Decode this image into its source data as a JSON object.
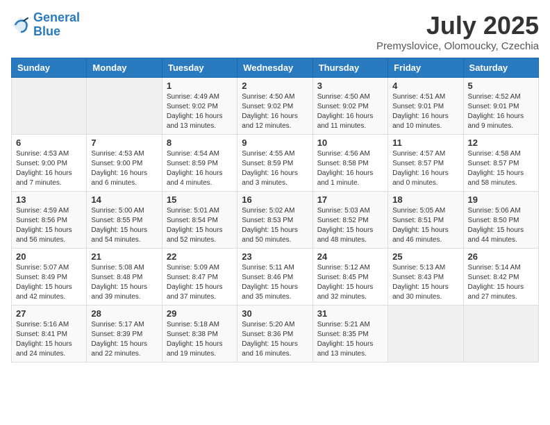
{
  "header": {
    "logo_line1": "General",
    "logo_line2": "Blue",
    "month": "July 2025",
    "location": "Premyslovice, Olomoucky, Czechia"
  },
  "weekdays": [
    "Sunday",
    "Monday",
    "Tuesday",
    "Wednesday",
    "Thursday",
    "Friday",
    "Saturday"
  ],
  "weeks": [
    [
      {
        "day": "",
        "info": ""
      },
      {
        "day": "",
        "info": ""
      },
      {
        "day": "1",
        "info": "Sunrise: 4:49 AM\nSunset: 9:02 PM\nDaylight: 16 hours and 13 minutes."
      },
      {
        "day": "2",
        "info": "Sunrise: 4:50 AM\nSunset: 9:02 PM\nDaylight: 16 hours and 12 minutes."
      },
      {
        "day": "3",
        "info": "Sunrise: 4:50 AM\nSunset: 9:02 PM\nDaylight: 16 hours and 11 minutes."
      },
      {
        "day": "4",
        "info": "Sunrise: 4:51 AM\nSunset: 9:01 PM\nDaylight: 16 hours and 10 minutes."
      },
      {
        "day": "5",
        "info": "Sunrise: 4:52 AM\nSunset: 9:01 PM\nDaylight: 16 hours and 9 minutes."
      }
    ],
    [
      {
        "day": "6",
        "info": "Sunrise: 4:53 AM\nSunset: 9:00 PM\nDaylight: 16 hours and 7 minutes."
      },
      {
        "day": "7",
        "info": "Sunrise: 4:53 AM\nSunset: 9:00 PM\nDaylight: 16 hours and 6 minutes."
      },
      {
        "day": "8",
        "info": "Sunrise: 4:54 AM\nSunset: 8:59 PM\nDaylight: 16 hours and 4 minutes."
      },
      {
        "day": "9",
        "info": "Sunrise: 4:55 AM\nSunset: 8:59 PM\nDaylight: 16 hours and 3 minutes."
      },
      {
        "day": "10",
        "info": "Sunrise: 4:56 AM\nSunset: 8:58 PM\nDaylight: 16 hours and 1 minute."
      },
      {
        "day": "11",
        "info": "Sunrise: 4:57 AM\nSunset: 8:57 PM\nDaylight: 16 hours and 0 minutes."
      },
      {
        "day": "12",
        "info": "Sunrise: 4:58 AM\nSunset: 8:57 PM\nDaylight: 15 hours and 58 minutes."
      }
    ],
    [
      {
        "day": "13",
        "info": "Sunrise: 4:59 AM\nSunset: 8:56 PM\nDaylight: 15 hours and 56 minutes."
      },
      {
        "day": "14",
        "info": "Sunrise: 5:00 AM\nSunset: 8:55 PM\nDaylight: 15 hours and 54 minutes."
      },
      {
        "day": "15",
        "info": "Sunrise: 5:01 AM\nSunset: 8:54 PM\nDaylight: 15 hours and 52 minutes."
      },
      {
        "day": "16",
        "info": "Sunrise: 5:02 AM\nSunset: 8:53 PM\nDaylight: 15 hours and 50 minutes."
      },
      {
        "day": "17",
        "info": "Sunrise: 5:03 AM\nSunset: 8:52 PM\nDaylight: 15 hours and 48 minutes."
      },
      {
        "day": "18",
        "info": "Sunrise: 5:05 AM\nSunset: 8:51 PM\nDaylight: 15 hours and 46 minutes."
      },
      {
        "day": "19",
        "info": "Sunrise: 5:06 AM\nSunset: 8:50 PM\nDaylight: 15 hours and 44 minutes."
      }
    ],
    [
      {
        "day": "20",
        "info": "Sunrise: 5:07 AM\nSunset: 8:49 PM\nDaylight: 15 hours and 42 minutes."
      },
      {
        "day": "21",
        "info": "Sunrise: 5:08 AM\nSunset: 8:48 PM\nDaylight: 15 hours and 39 minutes."
      },
      {
        "day": "22",
        "info": "Sunrise: 5:09 AM\nSunset: 8:47 PM\nDaylight: 15 hours and 37 minutes."
      },
      {
        "day": "23",
        "info": "Sunrise: 5:11 AM\nSunset: 8:46 PM\nDaylight: 15 hours and 35 minutes."
      },
      {
        "day": "24",
        "info": "Sunrise: 5:12 AM\nSunset: 8:45 PM\nDaylight: 15 hours and 32 minutes."
      },
      {
        "day": "25",
        "info": "Sunrise: 5:13 AM\nSunset: 8:43 PM\nDaylight: 15 hours and 30 minutes."
      },
      {
        "day": "26",
        "info": "Sunrise: 5:14 AM\nSunset: 8:42 PM\nDaylight: 15 hours and 27 minutes."
      }
    ],
    [
      {
        "day": "27",
        "info": "Sunrise: 5:16 AM\nSunset: 8:41 PM\nDaylight: 15 hours and 24 minutes."
      },
      {
        "day": "28",
        "info": "Sunrise: 5:17 AM\nSunset: 8:39 PM\nDaylight: 15 hours and 22 minutes."
      },
      {
        "day": "29",
        "info": "Sunrise: 5:18 AM\nSunset: 8:38 PM\nDaylight: 15 hours and 19 minutes."
      },
      {
        "day": "30",
        "info": "Sunrise: 5:20 AM\nSunset: 8:36 PM\nDaylight: 15 hours and 16 minutes."
      },
      {
        "day": "31",
        "info": "Sunrise: 5:21 AM\nSunset: 8:35 PM\nDaylight: 15 hours and 13 minutes."
      },
      {
        "day": "",
        "info": ""
      },
      {
        "day": "",
        "info": ""
      }
    ]
  ]
}
